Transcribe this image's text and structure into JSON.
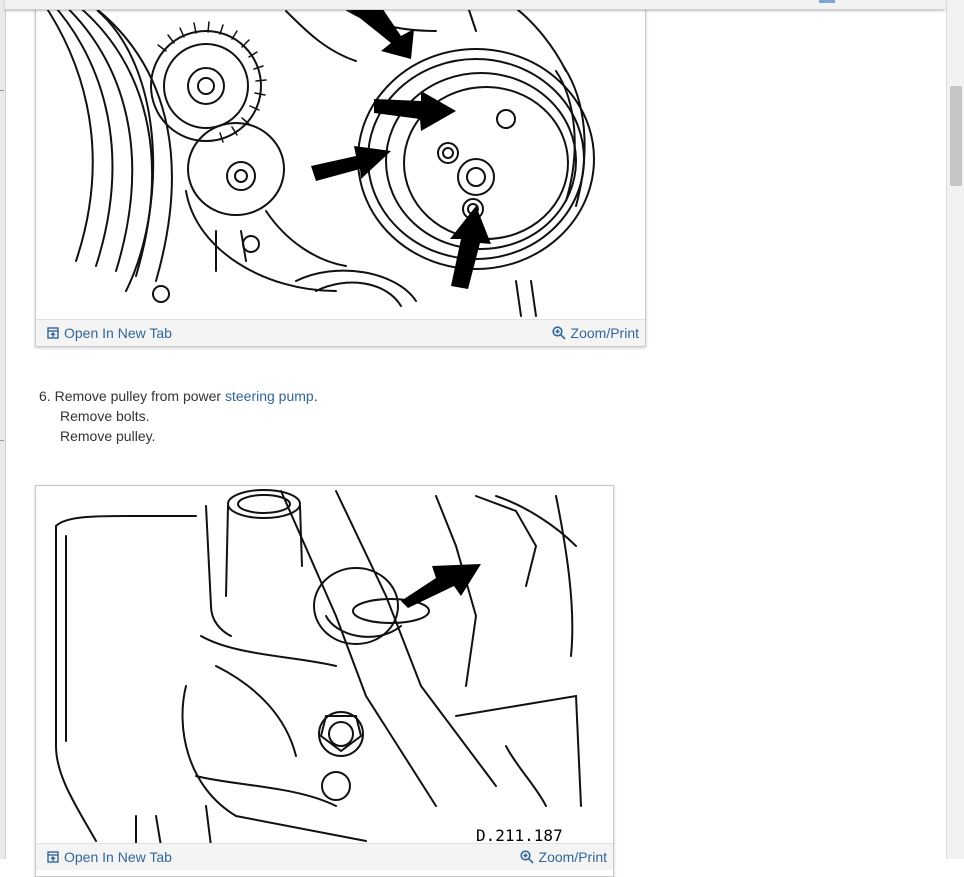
{
  "figure_1": {
    "open_tab_label": "Open In New Tab",
    "zoom_label": "Zoom/Print"
  },
  "step_6": {
    "number": "6.",
    "text_before": "Remove pulley from power",
    "link_text": "steering pump",
    "text_after": ".",
    "substeps": [
      "Remove bolts.",
      "Remove pulley."
    ]
  },
  "figure_2": {
    "caption_code": "D.211.187",
    "open_tab_label": "Open In New Tab",
    "zoom_label": "Zoom/Print"
  },
  "colors": {
    "link": "#336699",
    "text": "#333333"
  }
}
